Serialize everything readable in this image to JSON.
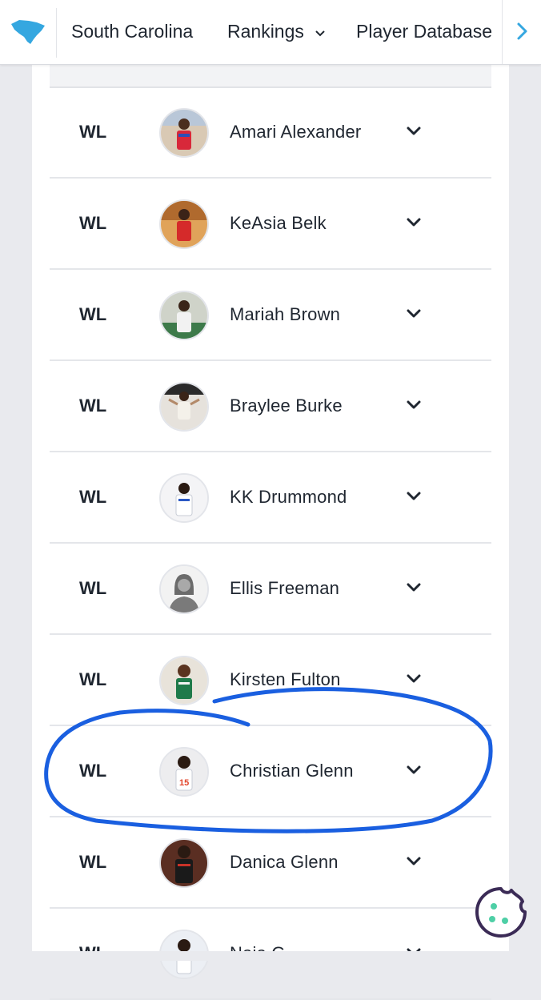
{
  "nav": {
    "state": "South Carolina",
    "rankings": "Rankings",
    "player_database": "Player Database"
  },
  "colors": {
    "logo": "#35a7e0",
    "annotation": "#1a5fe0",
    "cookie": "#3b2b56",
    "cookie_dots": "#4ecfa6"
  },
  "players": [
    {
      "tier": "WL",
      "name": "Amari Alexander"
    },
    {
      "tier": "WL",
      "name": "KeAsia Belk"
    },
    {
      "tier": "WL",
      "name": "Mariah Brown"
    },
    {
      "tier": "WL",
      "name": "Braylee Burke"
    },
    {
      "tier": "WL",
      "name": "KK Drummond"
    },
    {
      "tier": "WL",
      "name": "Ellis Freeman"
    },
    {
      "tier": "WL",
      "name": "Kirsten Fulton"
    },
    {
      "tier": "WL",
      "name": "Christian Glenn"
    },
    {
      "tier": "WL",
      "name": "Danica Glenn"
    },
    {
      "tier": "WL",
      "name": "Naia G"
    }
  ],
  "icons": {
    "logo": "south-carolina-state-icon",
    "expand": "chevron-down-icon",
    "next": "chevron-right-icon",
    "cookie": "cookie-icon"
  }
}
